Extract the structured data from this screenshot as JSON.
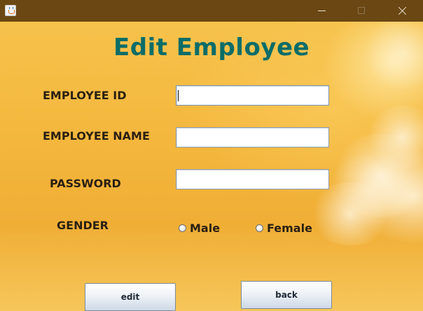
{
  "window": {
    "title": "",
    "icon": "java-coffee-icon",
    "controls": [
      "minimize-icon",
      "maximize-icon",
      "close-icon"
    ]
  },
  "form": {
    "title": "Edit Employee",
    "fields": {
      "employee_id": {
        "label": "EMPLOYEE ID",
        "value": ""
      },
      "employee_name": {
        "label": "EMPLOYEE NAME",
        "value": ""
      },
      "password": {
        "label": "PASSWORD",
        "value": ""
      }
    },
    "gender": {
      "label": "GENDER",
      "options": [
        "Male",
        "Female"
      ],
      "selected": null
    },
    "buttons": {
      "edit_label": "edit",
      "back_label": "back"
    }
  },
  "colors": {
    "titlebar": "#6b4713",
    "title_text": "#0a6d68",
    "label_text": "#2a1f12",
    "background": "#f2b53a"
  }
}
